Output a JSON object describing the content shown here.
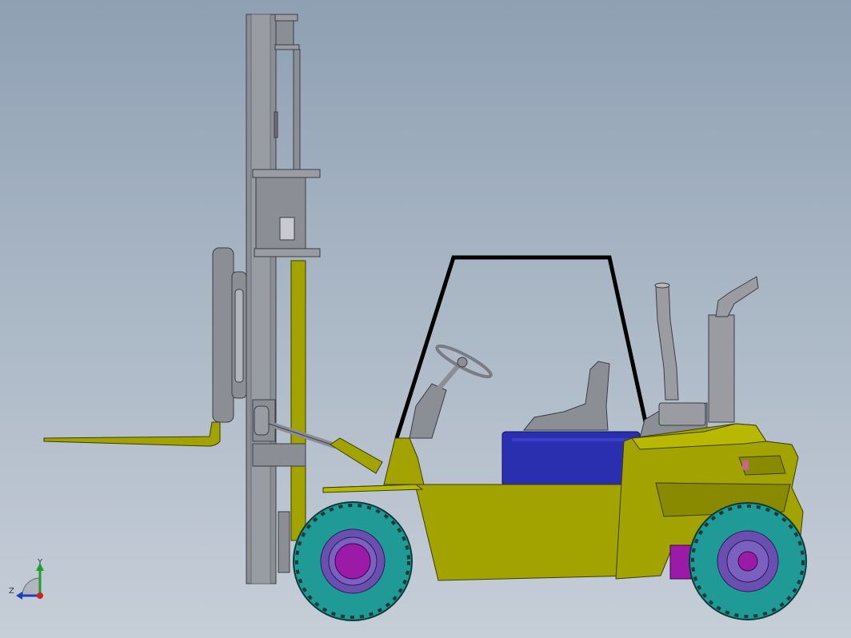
{
  "viewport": {
    "background_top": "#8fa0b4",
    "background_bottom": "#c6ced8"
  },
  "model": {
    "body_color": "#a3a300",
    "body_dark": "#8a8a00",
    "tire_color": "#1f9a96",
    "hub_color": "#6b4fb0",
    "hub_center_color": "#9c1aa8",
    "mast_color": "#8c8e96",
    "seat_color": "#2a2fb0",
    "cab_frame_color": "#000000",
    "exhaust_color": "#9a9ca2"
  },
  "triad": {
    "y_label": "Y",
    "z_label": "Z",
    "y_axis_color": "#1e9e2a",
    "z_axis_color": "#1f3fb8",
    "origin_color": "#d21f1f"
  }
}
